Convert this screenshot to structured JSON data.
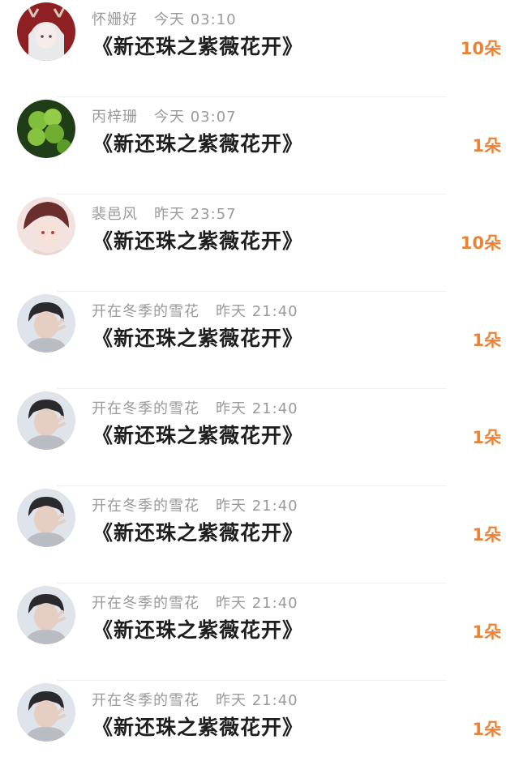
{
  "gifts": [
    {
      "avatar": "avatar-girl-antlers",
      "user": "怀姗好",
      "time": "今天 03:10",
      "title": "《新还珠之紫薇花开》",
      "count": "10朵"
    },
    {
      "avatar": "avatar-clover",
      "user": "丙梓珊",
      "time": "今天 03:07",
      "title": "《新还珠之紫薇花开》",
      "count": "1朵"
    },
    {
      "avatar": "avatar-anime-boy",
      "user": "裴邑风",
      "time": "昨天 23:57",
      "title": "《新还珠之紫薇花开》",
      "count": "10朵"
    },
    {
      "avatar": "avatar-boy-peace",
      "user": "开在冬季的雪花",
      "time": "昨天 21:40",
      "title": "《新还珠之紫薇花开》",
      "count": "1朵"
    },
    {
      "avatar": "avatar-boy-peace",
      "user": "开在冬季的雪花",
      "time": "昨天 21:40",
      "title": "《新还珠之紫薇花开》",
      "count": "1朵"
    },
    {
      "avatar": "avatar-boy-peace",
      "user": "开在冬季的雪花",
      "time": "昨天 21:40",
      "title": "《新还珠之紫薇花开》",
      "count": "1朵"
    },
    {
      "avatar": "avatar-boy-peace",
      "user": "开在冬季的雪花",
      "time": "昨天 21:40",
      "title": "《新还珠之紫薇花开》",
      "count": "1朵"
    },
    {
      "avatar": "avatar-boy-peace",
      "user": "开在冬季的雪花",
      "time": "昨天 21:40",
      "title": "《新还珠之紫薇花开》",
      "count": "1朵"
    }
  ],
  "colors": {
    "count": "#e8843a",
    "meta": "#9a9a9a",
    "title": "#1e1e1e"
  }
}
